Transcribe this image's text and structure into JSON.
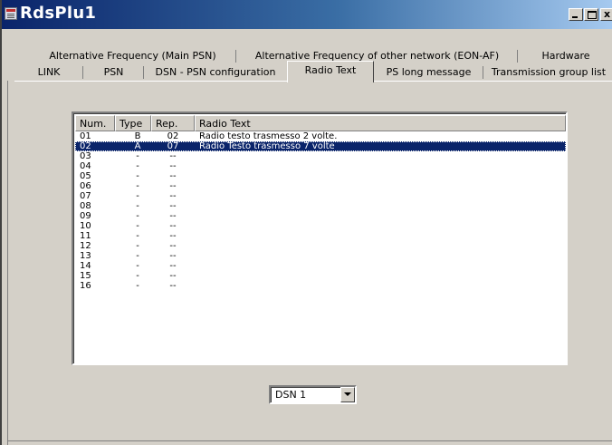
{
  "window": {
    "title": "RdsPlu1",
    "close_glyph": "x"
  },
  "tabs": {
    "row1": [
      {
        "label": "Alternative Frequency (Main PSN)"
      },
      {
        "label": "Alternative Frequency of other network (EON-AF)"
      },
      {
        "label": "Hardware"
      }
    ],
    "row2": [
      {
        "label": "LINK"
      },
      {
        "label": "PSN"
      },
      {
        "label": "DSN - PSN configuration"
      },
      {
        "label": "Radio Text"
      },
      {
        "label": "PS long message"
      },
      {
        "label": "Transmission group list"
      }
    ],
    "active": "Radio Text"
  },
  "list": {
    "columns": [
      "Num.",
      "Type",
      "Rep.",
      "Radio Text"
    ],
    "rows": [
      {
        "num": "01",
        "type": "B",
        "rep": "02",
        "text": "Radio testo trasmesso 2 volte."
      },
      {
        "num": "02",
        "type": "A",
        "rep": "07",
        "text": "Radio Testo trasmesso 7 volte"
      },
      {
        "num": "03",
        "type": "-",
        "rep": "--",
        "text": ""
      },
      {
        "num": "04",
        "type": "-",
        "rep": "--",
        "text": ""
      },
      {
        "num": "05",
        "type": "-",
        "rep": "--",
        "text": ""
      },
      {
        "num": "06",
        "type": "-",
        "rep": "--",
        "text": ""
      },
      {
        "num": "07",
        "type": "-",
        "rep": "--",
        "text": ""
      },
      {
        "num": "08",
        "type": "-",
        "rep": "--",
        "text": ""
      },
      {
        "num": "09",
        "type": "-",
        "rep": "--",
        "text": ""
      },
      {
        "num": "10",
        "type": "-",
        "rep": "--",
        "text": ""
      },
      {
        "num": "11",
        "type": "-",
        "rep": "--",
        "text": ""
      },
      {
        "num": "12",
        "type": "-",
        "rep": "--",
        "text": ""
      },
      {
        "num": "13",
        "type": "-",
        "rep": "--",
        "text": ""
      },
      {
        "num": "14",
        "type": "-",
        "rep": "--",
        "text": ""
      },
      {
        "num": "15",
        "type": "-",
        "rep": "--",
        "text": ""
      },
      {
        "num": "16",
        "type": "-",
        "rep": "--",
        "text": ""
      }
    ],
    "selected_num": "02"
  },
  "dsn_select": {
    "value": "DSN 1"
  },
  "colors": {
    "face": "#d4d0c8",
    "selection": "#0a246a",
    "title_gradient_start": "#0a246a",
    "title_gradient_end": "#a6caf0"
  },
  "icons": {
    "app": "app-window-icon",
    "minimize": "minimize-icon",
    "maximize": "maximize-icon",
    "close": "close-icon",
    "dropdown": "chevron-down-icon"
  }
}
